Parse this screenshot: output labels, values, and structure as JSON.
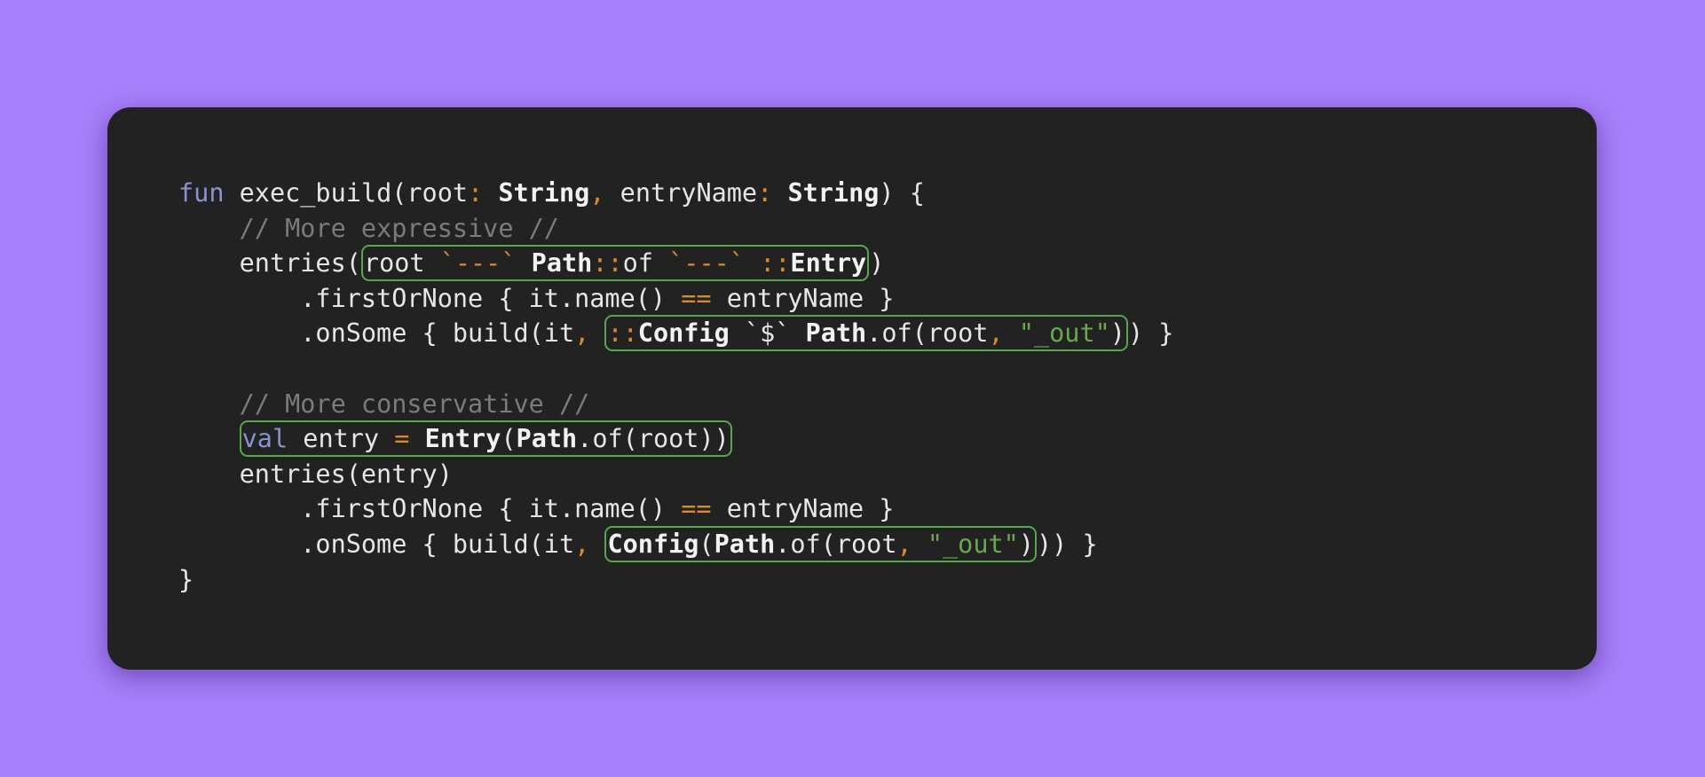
{
  "code": {
    "lines": [
      [
        {
          "t": "fun",
          "c": "kw"
        },
        {
          "t": " exec_build(root",
          "c": "pl"
        },
        {
          "t": ":",
          "c": "op"
        },
        {
          "t": " ",
          "c": "pl"
        },
        {
          "t": "String",
          "c": "ty"
        },
        {
          "t": ",",
          "c": "op"
        },
        {
          "t": " entryName",
          "c": "pl"
        },
        {
          "t": ":",
          "c": "op"
        },
        {
          "t": " ",
          "c": "pl"
        },
        {
          "t": "String",
          "c": "ty"
        },
        {
          "t": ") {",
          "c": "pl"
        }
      ],
      [
        {
          "t": "    ",
          "c": "pl"
        },
        {
          "t": "// More expressive //",
          "c": "cm"
        }
      ],
      [
        {
          "t": "    entries(",
          "c": "pl"
        },
        {
          "hl": [
            {
              "t": "root ",
              "c": "pl"
            },
            {
              "t": "`---`",
              "c": "op"
            },
            {
              "t": " ",
              "c": "pl"
            },
            {
              "t": "Path",
              "c": "ty"
            },
            {
              "t": "::",
              "c": "op"
            },
            {
              "t": "of ",
              "c": "pl"
            },
            {
              "t": "`---`",
              "c": "op"
            },
            {
              "t": " ",
              "c": "pl"
            },
            {
              "t": "::",
              "c": "op"
            },
            {
              "t": "Entry",
              "c": "ty"
            }
          ]
        },
        {
          "t": ")",
          "c": "pl"
        }
      ],
      [
        {
          "t": "        .firstOrNone { it.name() ",
          "c": "pl"
        },
        {
          "t": "==",
          "c": "op"
        },
        {
          "t": " entryName }",
          "c": "pl"
        }
      ],
      [
        {
          "t": "        .onSome { build(it",
          "c": "pl"
        },
        {
          "t": ",",
          "c": "op"
        },
        {
          "t": " ",
          "c": "pl"
        },
        {
          "hl": [
            {
              "t": "::",
              "c": "op"
            },
            {
              "t": "Config",
              "c": "ty"
            },
            {
              "t": " `$` ",
              "c": "pl"
            },
            {
              "t": "Path",
              "c": "ty"
            },
            {
              "t": ".of(root",
              "c": "pl"
            },
            {
              "t": ",",
              "c": "op"
            },
            {
              "t": " ",
              "c": "pl"
            },
            {
              "t": "\"_out\"",
              "c": "str"
            },
            {
              "t": ")",
              "c": "pl"
            }
          ]
        },
        {
          "t": ") }",
          "c": "pl"
        }
      ],
      [
        {
          "t": "",
          "c": "pl"
        }
      ],
      [
        {
          "t": "    ",
          "c": "pl"
        },
        {
          "t": "// More conservative //",
          "c": "cm"
        }
      ],
      [
        {
          "t": "    ",
          "c": "pl"
        },
        {
          "hl": [
            {
              "t": "val",
              "c": "kw"
            },
            {
              "t": " entry ",
              "c": "pl"
            },
            {
              "t": "=",
              "c": "op"
            },
            {
              "t": " ",
              "c": "pl"
            },
            {
              "t": "Entry",
              "c": "ty"
            },
            {
              "t": "(",
              "c": "pl"
            },
            {
              "t": "Path",
              "c": "ty"
            },
            {
              "t": ".of(root))",
              "c": "pl"
            }
          ]
        }
      ],
      [
        {
          "t": "    entries(entry)",
          "c": "pl"
        }
      ],
      [
        {
          "t": "        .firstOrNone { it.name() ",
          "c": "pl"
        },
        {
          "t": "==",
          "c": "op"
        },
        {
          "t": " entryName }",
          "c": "pl"
        }
      ],
      [
        {
          "t": "        .onSome { build(it",
          "c": "pl"
        },
        {
          "t": ",",
          "c": "op"
        },
        {
          "t": " ",
          "c": "pl"
        },
        {
          "hl": [
            {
              "t": "Config",
              "c": "ty"
            },
            {
              "t": "(",
              "c": "pl"
            },
            {
              "t": "Path",
              "c": "ty"
            },
            {
              "t": ".of(root",
              "c": "pl"
            },
            {
              "t": ",",
              "c": "op"
            },
            {
              "t": " ",
              "c": "pl"
            },
            {
              "t": "\"_out\"",
              "c": "str"
            },
            {
              "t": ")",
              "c": "pl"
            }
          ]
        },
        {
          "t": ")) }",
          "c": "pl"
        }
      ],
      [
        {
          "t": "}",
          "c": "pl"
        }
      ]
    ]
  }
}
